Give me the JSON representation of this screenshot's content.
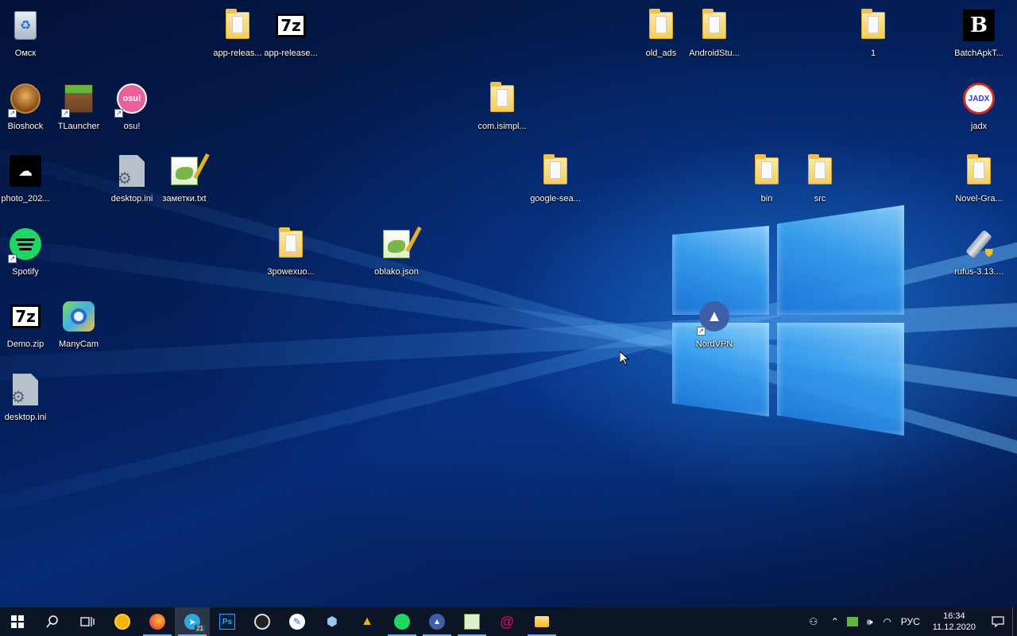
{
  "desktop": {
    "icons": {
      "omsk": "Омск",
      "bioshock": "Bioshock",
      "tlauncher": "TLauncher",
      "osu": "osu!",
      "photo": "photo_202...",
      "desktop_ini_1": "desktop.ini",
      "zametki": "заметки.txt",
      "spotify": "Spotify",
      "zrow": "3powexuo...",
      "oblako": "oblako.json",
      "demo_zip": "Demo.zip",
      "manycam": "ManyCam",
      "desktop_ini_2": "desktop.ini",
      "app_release_1": "app-releas...",
      "app_release_2": "app-release...",
      "com_isimpl": "com.isimpl...",
      "google_sea": "google-sea...",
      "nordvpn": "NordVPN",
      "old_ads": "old_ads",
      "android_stu": "AndroidStu...",
      "bin": "bin",
      "src": "src",
      "one": "1",
      "batchapk": "BatchApkT...",
      "jadx": "jadx",
      "novel_gra": "Novel-Gra...",
      "rufus": "rufus-3.13...."
    },
    "glyphs": {
      "sevenz": "7z",
      "osu": "osu!",
      "batch": "B",
      "jadx": "JADX",
      "telegram_badge": "21",
      "photoshop": "Ps"
    }
  },
  "taskbar": {
    "clock_time": "16:34",
    "clock_date": "11.12.2020",
    "language": "РУС"
  },
  "colors": {
    "taskbar_bg": "#0b1526",
    "accent": "#7aaee8",
    "spotify": "#1ed760",
    "osu": "#e8609c"
  }
}
